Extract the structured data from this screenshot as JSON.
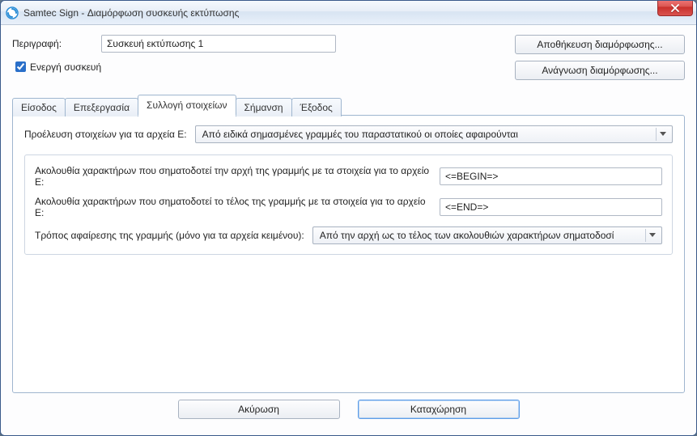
{
  "window": {
    "title": "Samtec Sign - Διαμόρφωση συσκευής εκτύπωσης",
    "icon": "app-icon"
  },
  "header": {
    "description_label": "Περιγραφή:",
    "description_value": "Συσκευή εκτύπωσης 1",
    "active_device_label": "Ενεργή συσκευή",
    "active_device_checked": true,
    "save_config_label": "Αποθήκευση διαμόρφωσης...",
    "load_config_label": "Ανάγνωση διαμόρφωσης..."
  },
  "tabs": [
    {
      "label": "Είσοδος"
    },
    {
      "label": "Επεξεργασία"
    },
    {
      "label": "Συλλογή στοιχείων"
    },
    {
      "label": "Σήμανση"
    },
    {
      "label": "Έξοδος"
    }
  ],
  "active_tab_index": 2,
  "panel": {
    "source_label": "Προέλευση στοιχείων για τα αρχεία E:",
    "source_value": "Από ειδικά σημασμένες γραμμές του παραστατικού οι οποίες αφαιρούνται",
    "begin_label": "Ακολουθία χαρακτήρων που σηματοδοτεί την αρχή της γραμμής με τα στοιχεία για το αρχείο E:",
    "begin_value": "<=BEGIN=>",
    "end_label": "Ακολουθία χαρακτήρων που σηματοδοτεί το τέλος της γραμμής με τα στοιχεία για το αρχείο E:",
    "end_value": "<=END=>",
    "remove_label": "Τρόπος αφαίρεσης της γραμμής (μόνο για τα αρχεία κειμένου):",
    "remove_value": "Από την αρχή ως το τέλος των ακολουθιών χαρακτήρων σηματοδοσί"
  },
  "footer": {
    "cancel_label": "Ακύρωση",
    "submit_label": "Καταχώρηση"
  }
}
